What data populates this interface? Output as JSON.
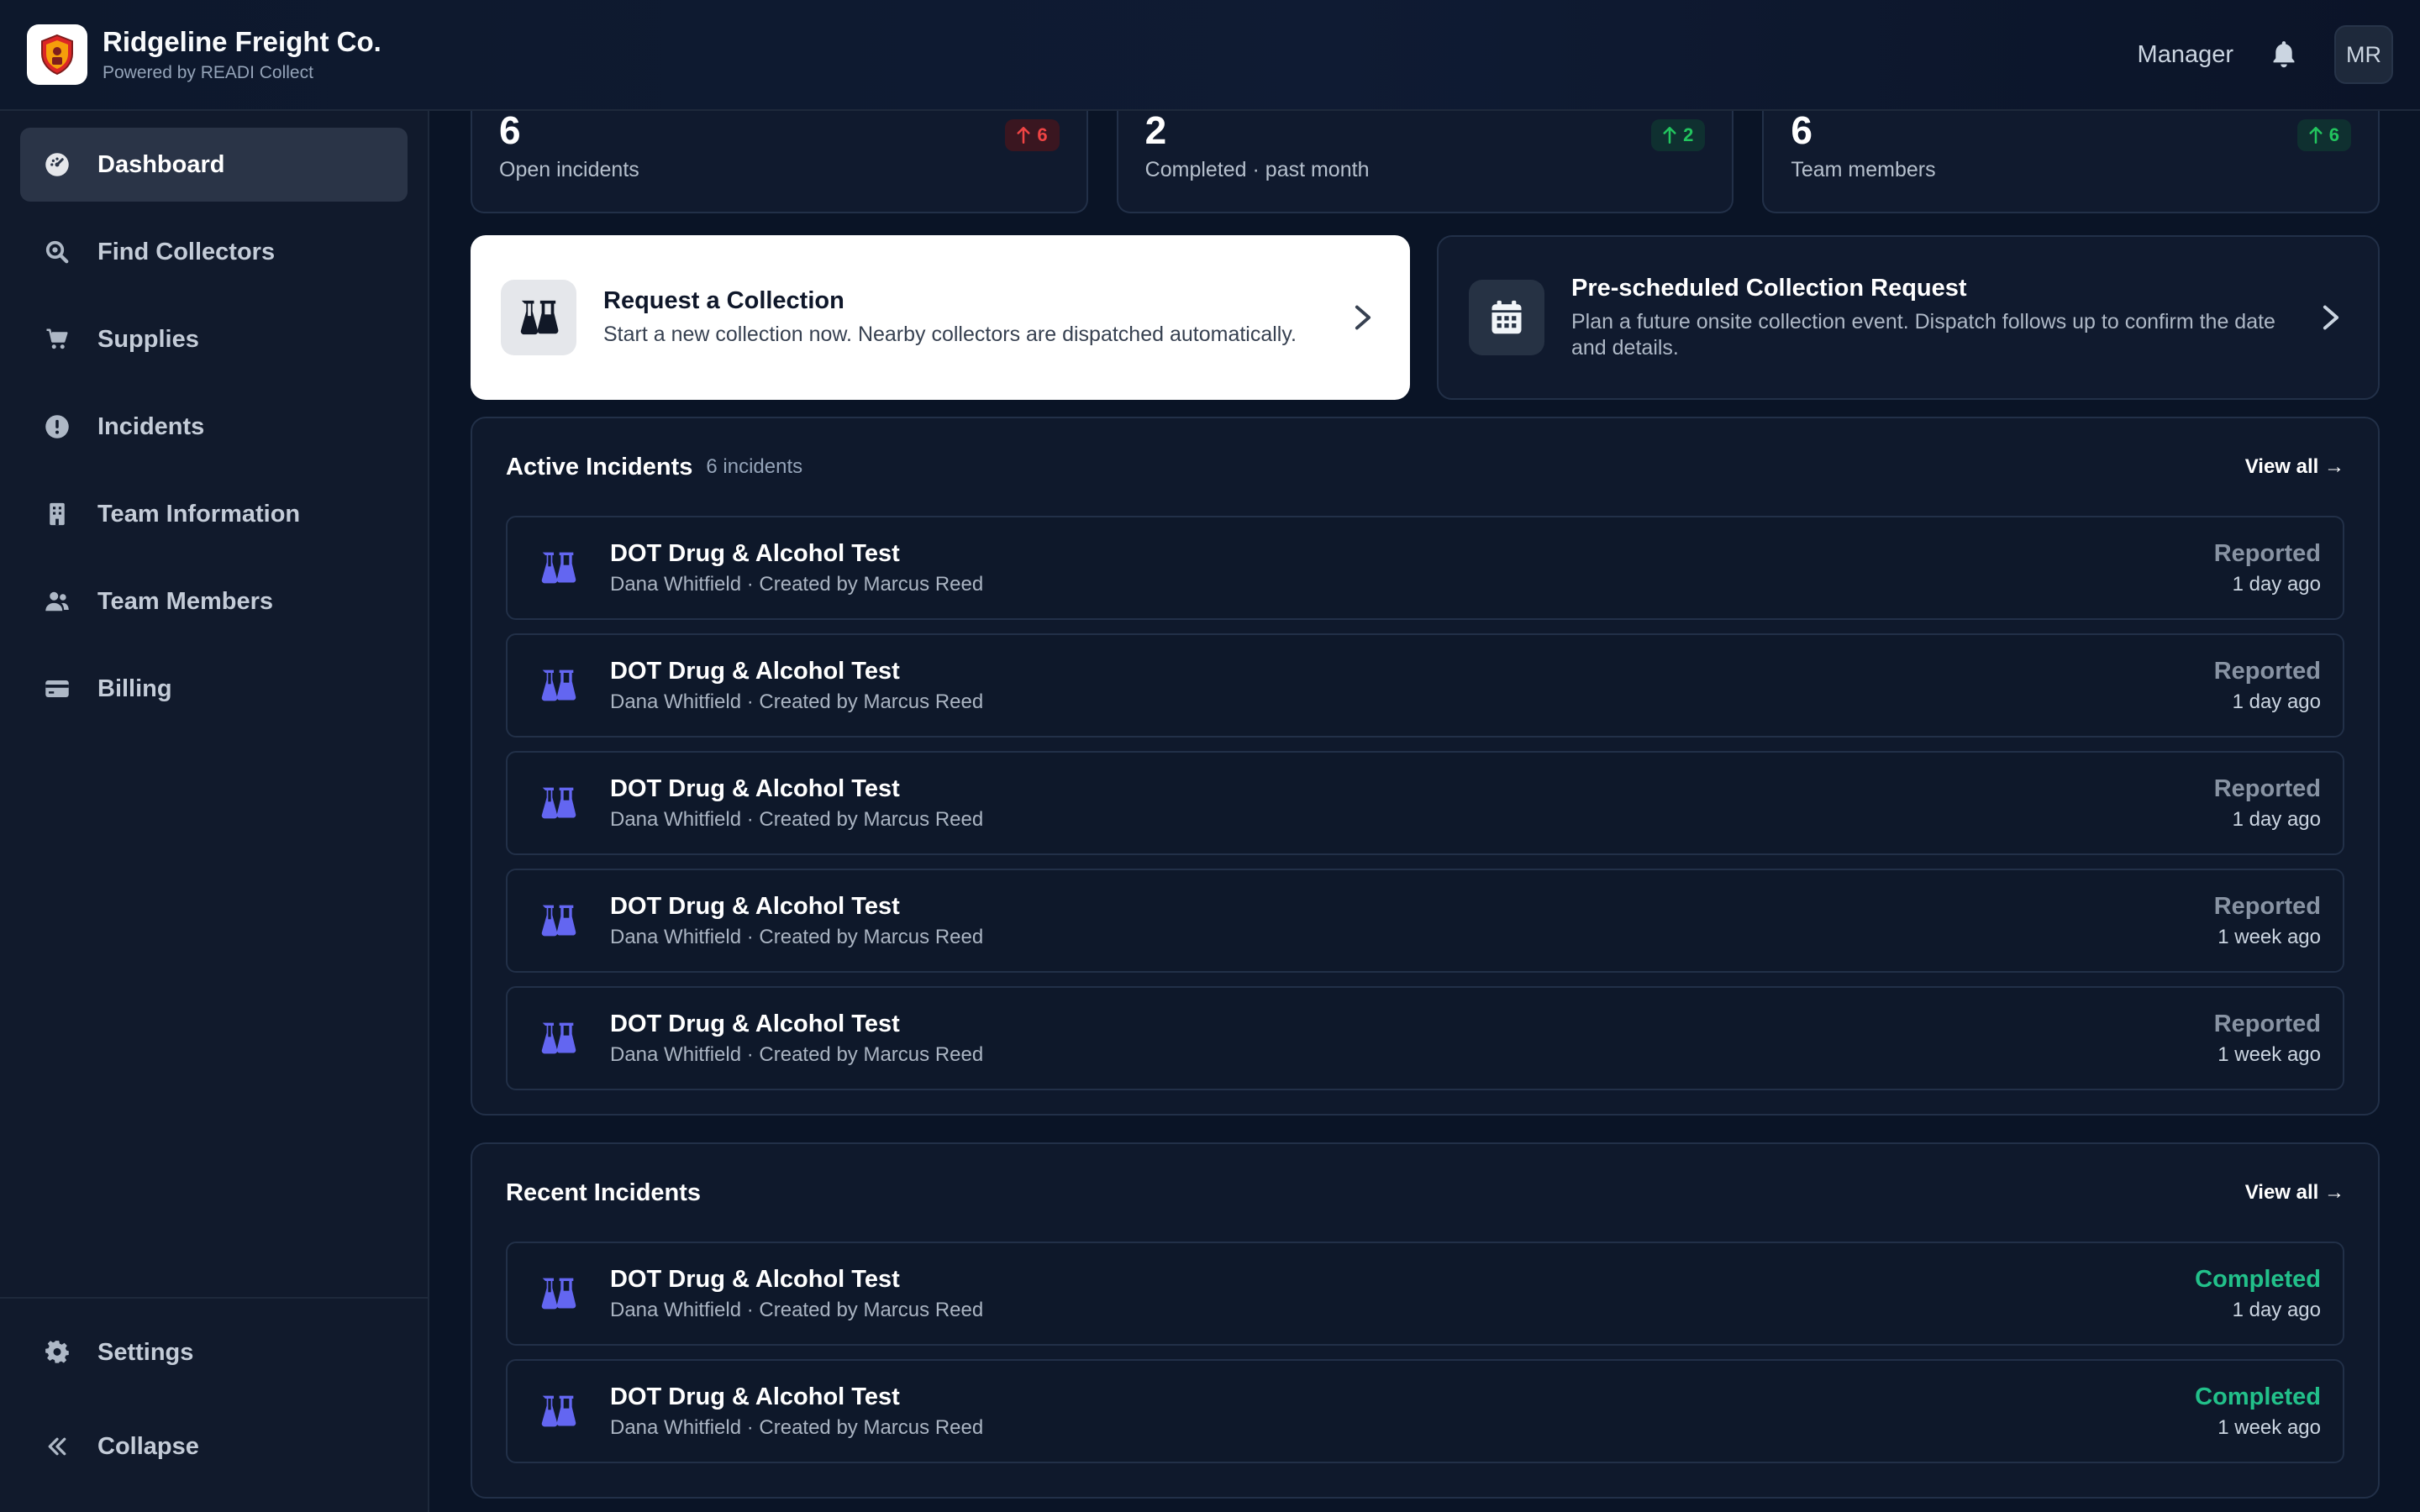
{
  "header": {
    "brand_name": "Ridgeline Freight Co.",
    "brand_sub": "Powered by READI Collect",
    "role": "Manager",
    "avatar_initials": "MR"
  },
  "sidebar": {
    "items": [
      {
        "label": "Dashboard",
        "icon": "gauge-icon",
        "active": true
      },
      {
        "label": "Find Collectors",
        "icon": "search-icon"
      },
      {
        "label": "Supplies",
        "icon": "cart-icon"
      },
      {
        "label": "Incidents",
        "icon": "alert-circle-icon"
      },
      {
        "label": "Team Information",
        "icon": "building-icon"
      },
      {
        "label": "Team Members",
        "icon": "users-icon"
      },
      {
        "label": "Billing",
        "icon": "credit-card-icon"
      }
    ],
    "settings_label": "Settings",
    "collapse_label": "Collapse"
  },
  "stats": [
    {
      "value": "6",
      "label": "Open incidents",
      "badge": "6",
      "trend": "up",
      "color": "#ef4444"
    },
    {
      "value": "2",
      "label": "Completed · past month",
      "badge": "2",
      "trend": "up",
      "color": "#22c55e"
    },
    {
      "value": "6",
      "label": "Team members",
      "badge": "6",
      "trend": "up",
      "color": "#22c55e"
    }
  ],
  "actions": {
    "request": {
      "title": "Request a Collection",
      "desc": "Start a new collection now. Nearby collectors are dispatched automatically."
    },
    "prescheduled": {
      "title": "Pre-scheduled Collection Request",
      "desc": "Plan a future onsite collection event. Dispatch follows up to confirm the date and details."
    }
  },
  "active": {
    "title": "Active Incidents",
    "count": "6 incidents",
    "view_all": "View all →",
    "rows": [
      {
        "title": "DOT Drug & Alcohol Test",
        "sub": "Dana Whitfield · Created by Marcus Reed",
        "status": "Reported",
        "time": "1 day ago"
      },
      {
        "title": "DOT Drug & Alcohol Test",
        "sub": "Dana Whitfield · Created by Marcus Reed",
        "status": "Reported",
        "time": "1 day ago"
      },
      {
        "title": "DOT Drug & Alcohol Test",
        "sub": "Dana Whitfield · Created by Marcus Reed",
        "status": "Reported",
        "time": "1 day ago"
      },
      {
        "title": "DOT Drug & Alcohol Test",
        "sub": "Dana Whitfield · Created by Marcus Reed",
        "status": "Reported",
        "time": "1 week ago"
      },
      {
        "title": "DOT Drug & Alcohol Test",
        "sub": "Dana Whitfield · Created by Marcus Reed",
        "status": "Reported",
        "time": "1 week ago"
      }
    ]
  },
  "recent": {
    "title": "Recent Incidents",
    "view_all": "View all →",
    "rows": [
      {
        "title": "DOT Drug & Alcohol Test",
        "sub": "Dana Whitfield · Created by Marcus Reed",
        "status": "Completed",
        "time": "1 day ago"
      },
      {
        "title": "DOT Drug & Alcohol Test",
        "sub": "Dana Whitfield · Created by Marcus Reed",
        "status": "Completed",
        "time": "1 week ago"
      }
    ]
  },
  "colors": {
    "accent_icon": "#6366f1",
    "completed": "#22c08a",
    "reported": "#8893a3"
  }
}
